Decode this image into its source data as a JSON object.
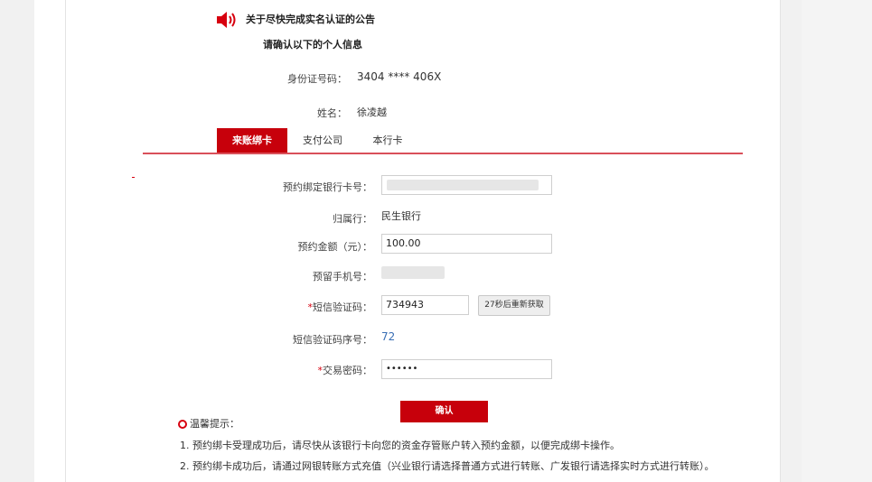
{
  "notice": {
    "icon": "speaker-icon",
    "title": "关于尽快完成实名认证的公告"
  },
  "confirm_heading": "请确认以下的个人信息",
  "identity": {
    "id_label": "身份证号码：",
    "id_value": "3404 **** 406X",
    "name_label": "姓名：",
    "name_value": "徐凌越"
  },
  "tabs": [
    {
      "label": "来账绑卡",
      "active": true
    },
    {
      "label": "支付公司",
      "active": false
    },
    {
      "label": "本行卡",
      "active": false
    }
  ],
  "form": {
    "card_label": "预约绑定银行卡号：",
    "bank_label": "归属行：",
    "bank_value": "民生银行",
    "amount_label": "预约金额（元）：",
    "amount_value": "100.00",
    "phone_label": "预留手机号：",
    "sms_required_mark": "*",
    "sms_label": "短信验证码：",
    "sms_value": "734943",
    "sms_button": "27秒后重新获取",
    "sms_seq_label": "短信验证码序号：",
    "sms_seq_value": "72",
    "pwd_required_mark": "*",
    "pwd_label": "交易密码：",
    "pwd_value": "••••••"
  },
  "confirm_button": "确认",
  "tips": {
    "title": "温馨提示：",
    "items": [
      "1. 预约绑卡受理成功后，请尽快从该银行卡向您的资金存管账户转入预约金额，以便完成绑卡操作。",
      "2. 预约绑卡成功后，请通过网银转账方式充值（兴业银行请选择普通方式进行转账、广发银行请选择实时方式进行转账）。"
    ]
  },
  "colors": {
    "accent": "#c7000b",
    "link": "#3a6fb5"
  }
}
